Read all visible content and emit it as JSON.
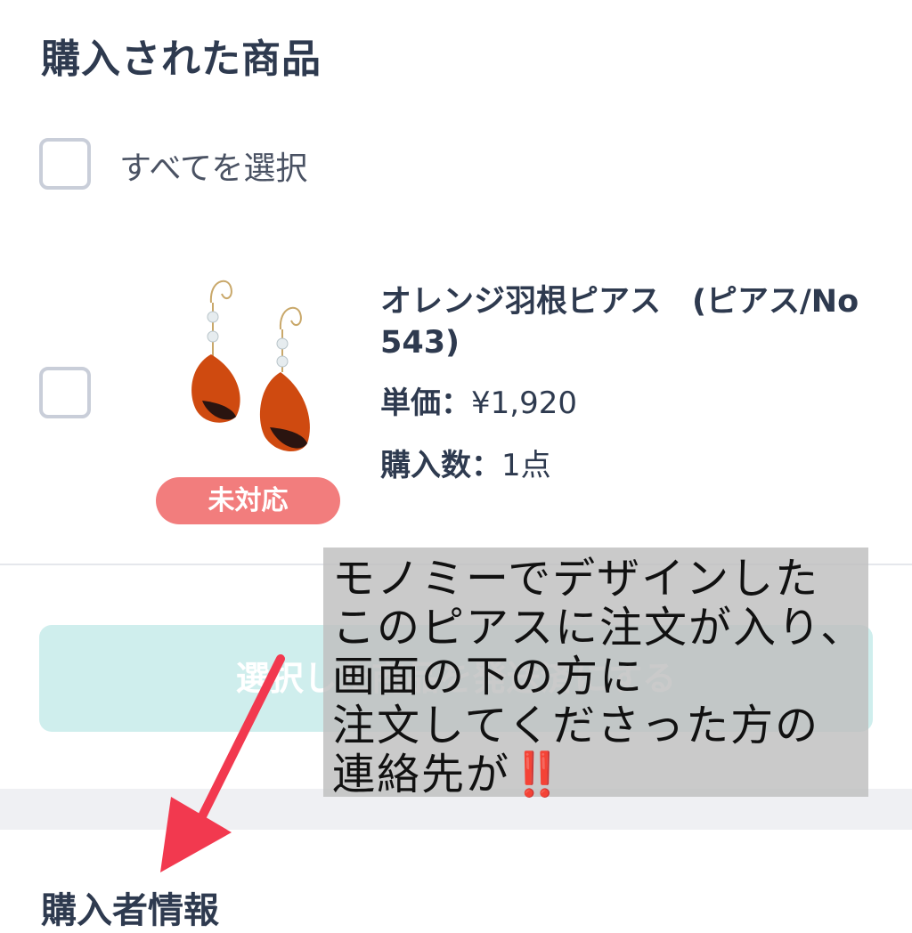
{
  "page": {
    "title": "購入された商品",
    "select_all_label": "すべてを選択"
  },
  "product": {
    "name": "オレンジ羽根ピアス　(ピアス/No543)",
    "status_badge": "未対応",
    "price_key": "単価：",
    "price_value": "¥1,920",
    "qty_key": "購入数：",
    "qty_value": "1点",
    "image_icon": "earring-photo"
  },
  "action_button_label": "選択した商品を発送済にする",
  "section": {
    "buyer_info_title": "購入者情報"
  },
  "annotation": {
    "text": "モノミーでデザインした\nこのピアスに注文が入り、\n画面の下の方に\n注文してくださった方の\n連絡先が",
    "emphasis": "‼️"
  },
  "colors": {
    "badge": "#f27d7d",
    "button": "#cfeeed",
    "arrow": "#f2394f",
    "text": "#2e3a4f"
  }
}
